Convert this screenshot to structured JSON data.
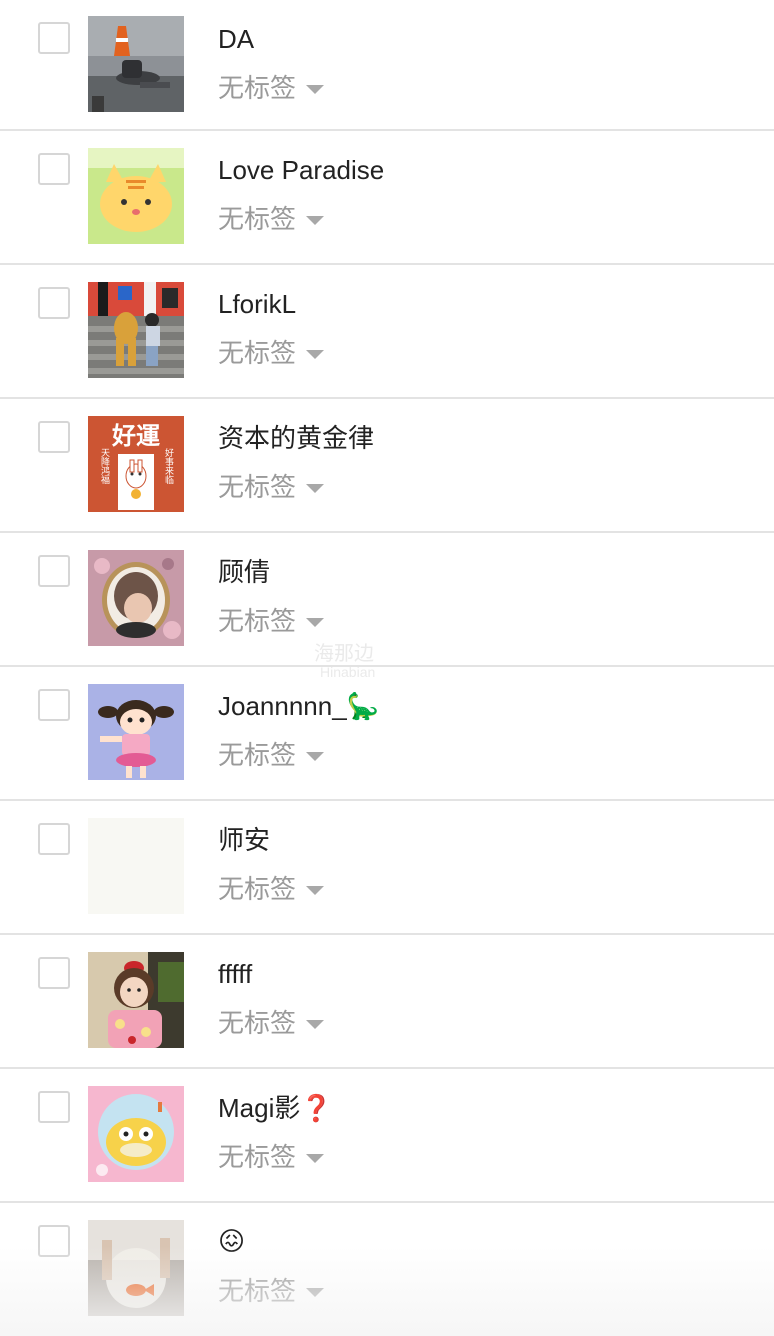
{
  "contacts": [
    {
      "name": "DA",
      "tag": "无标签",
      "avatar": "street-photo-avatar"
    },
    {
      "name": "Love Paradise",
      "tag": "无标签",
      "avatar": "cartoon-cat-avatar"
    },
    {
      "name": "LforikL",
      "tag": "无标签",
      "avatar": "stairs-photo-avatar"
    },
    {
      "name": "资本的黄金律",
      "tag": "无标签",
      "avatar": "good-luck-card-avatar"
    },
    {
      "name": "顾倩",
      "tag": "无标签",
      "avatar": "portrait-frame-avatar"
    },
    {
      "name": "Joannnnn_🦕",
      "tag": "无标签",
      "avatar": "cartoon-girl-avatar"
    },
    {
      "name": "师安",
      "tag": "无标签",
      "avatar": "blank-avatar"
    },
    {
      "name": "fffff",
      "tag": "无标签",
      "avatar": "child-photo-avatar"
    },
    {
      "name": "Magi影❓",
      "tag": "无标签",
      "avatar": "duck-cartoon-avatar"
    },
    {
      "name": "😖",
      "tag": "无标签",
      "avatar": "goldfish-bowl-avatar"
    }
  ],
  "watermark": {
    "main": "海那边",
    "sub": "Hinabian"
  },
  "avatar_card_text": {
    "title": "好運",
    "left": "天降鸿福",
    "right": "好事来临"
  },
  "colors": {
    "divider": "#e3e3e3",
    "name_text": "#222222",
    "tag_text": "#9a9a9a",
    "checkbox_border": "#d6d6d6"
  }
}
